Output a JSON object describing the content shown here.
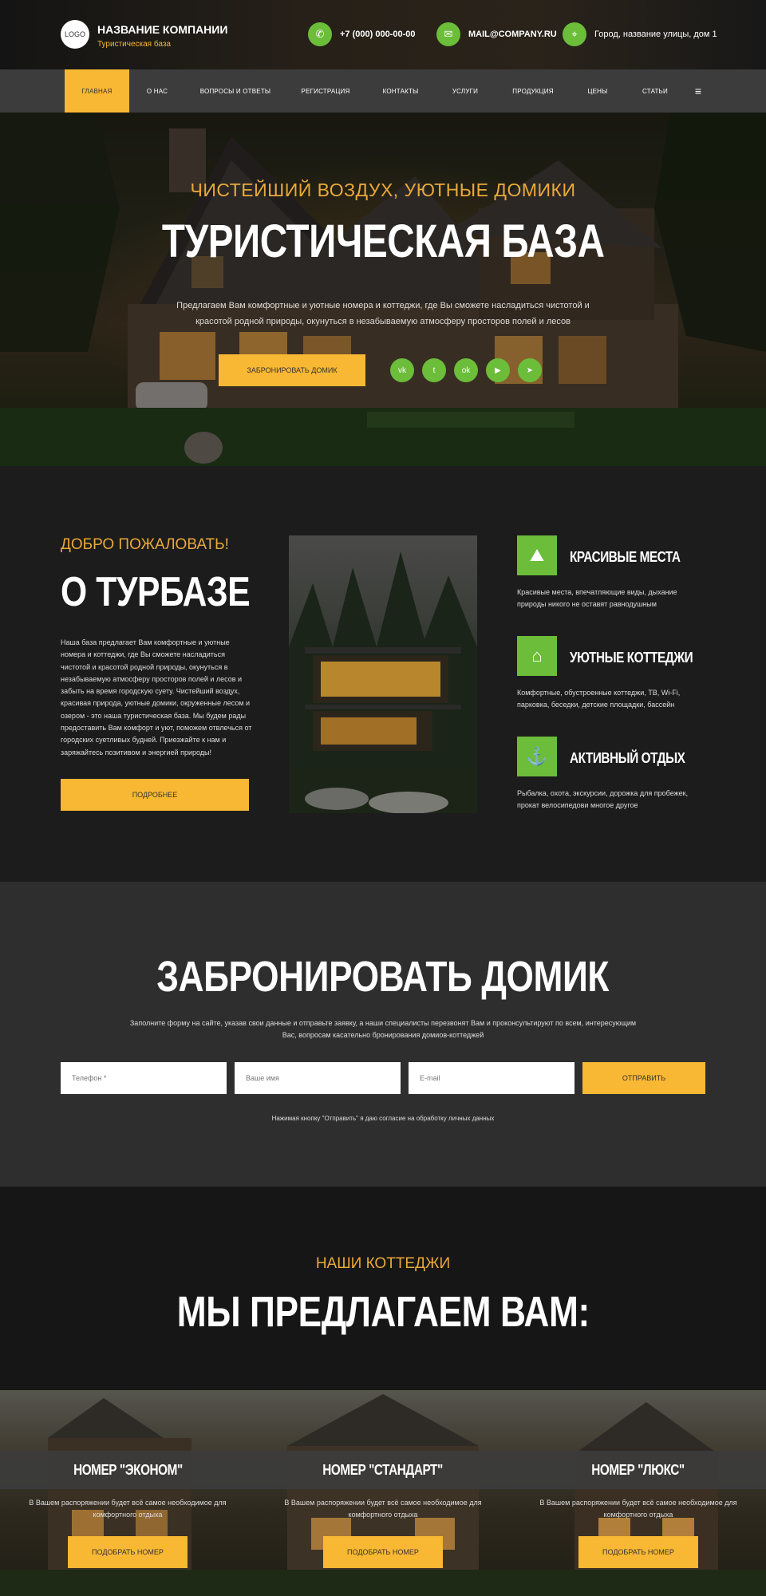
{
  "header": {
    "logo": "LOGO",
    "company_name": "НАЗВАНИЕ КОМПАНИИ",
    "tagline": "Туристическая база",
    "phone": "+7 (000) 000-00-00",
    "email": "MAIL@COMPANY.RU",
    "address": "Город, название улицы, дом 1",
    "accent_color": "#6bbd3a",
    "brand_color": "#f8b833"
  },
  "nav": {
    "items": [
      {
        "label": "ГЛАВНАЯ"
      },
      {
        "label": "О НАС"
      },
      {
        "label": "ВОПРОСЫ И ОТВЕТЫ"
      },
      {
        "label": "РЕГИСТРАЦИЯ"
      },
      {
        "label": "КОНТАКТЫ"
      },
      {
        "label": "УСЛУГИ"
      },
      {
        "label": "ПРОДУКЦИЯ"
      },
      {
        "label": "ЦЕНЫ"
      },
      {
        "label": "СТАТЬИ"
      }
    ],
    "menu_icon": "≡"
  },
  "hero": {
    "subtitle": "ЧИСТЕЙШИЙ ВОЗДУХ, УЮТНЫЕ ДОМИКИ",
    "title": "ТУРИСТИЧЕСКАЯ БАЗА",
    "text": "Предлагаем Вам комфортные и уютные номера и коттеджи, где Вы сможете насладиться чистотой и красотой родной природы, окунуться в незабываемую атмосферу просторов полей и лесов",
    "button": "ЗАБРОНИРОВАТЬ ДОМИК",
    "socials": [
      "vk",
      "twitter",
      "ok",
      "youtube",
      "telegram"
    ]
  },
  "about": {
    "pre": "ДОБРО ПОЖАЛОВАТЬ!",
    "title": "О ТУРБАЗЕ",
    "text": "Наша база предлагает Вам комфортные и уютные номера и коттеджи, где Вы сможете насладиться чистотой и красотой родной природы, окунуться в незабываемую атмосферу просторов полей и лесов и забыть на время городскую суету. Чистейший воздух, красивая природа, уютные домики, окруженные лесом и озером - это наша туристическая база. Мы будем рады предоставить Вам комфорт и уют, поможем отвлечься от городских суетливых будней. Приезжайте к нам и заряжайтесь позитивом и энергией природы!",
    "button": "ПОДРОБНЕЕ",
    "features": [
      {
        "title": "КРАСИВЫЕ МЕСТА",
        "text": "Красивые места, впечатляющие виды, дыхание природы никого не оставят равнодушным",
        "icon": "landscape-icon"
      },
      {
        "title": "УЮТНЫЕ КОТТЕДЖИ",
        "text": "Комфортные, обустроенные коттеджи, ТВ, Wi-Fi, парковка, беседки, детские площадки, бассейн",
        "icon": "cottage-icon"
      },
      {
        "title": "АКТИВНЫЙ ОТДЫХ",
        "text": "Рыбалка, охота, экскурсии, дорожка для пробежек, прокат велосипедови многое другое",
        "icon": "fishing-icon"
      }
    ]
  },
  "booking": {
    "title": "ЗАБРОНИРОВАТЬ ДОМИК",
    "text": "Заполните форму на сайте, указав свои данные и отправьте заявку, а наши специалисты перезвонят Вам и проконсультируют по всем, интересующим Вас, вопросам касательно бронирования домиов-коттеджей",
    "phone_placeholder": "Телефон *",
    "name_placeholder": "Ваше имя",
    "email_placeholder": "E-mail",
    "button": "ОТПРАВИТЬ",
    "note": "Нажимая кнопку \"Отправить\" я даю согласие на обработку личных данных"
  },
  "cottages": {
    "pre": "НАШИ КОТТЕДЖИ",
    "title": "МЫ ПРЕДЛАГАЕМ ВАМ:",
    "cards": [
      {
        "title": "НОМЕР \"ЭКОНОМ\"",
        "text": "В Вашем распоряжении будет всё самое необходимое для комфортного отдыха",
        "button": "ПОДОБРАТЬ НОМЕР"
      },
      {
        "title": "НОМЕР \"СТАНДАРТ\"",
        "text": "В Вашем распоряжении будет всё самое необходимое для комфортного отдыха",
        "button": "ПОДОБРАТЬ НОМЕР"
      },
      {
        "title": "НОМЕР \"ЛЮКС\"",
        "text": "В Вашем распоряжении будет всё самое необходимое для комфортного отдыха",
        "button": "ПОДОБРАТЬ НОМЕР"
      }
    ]
  }
}
